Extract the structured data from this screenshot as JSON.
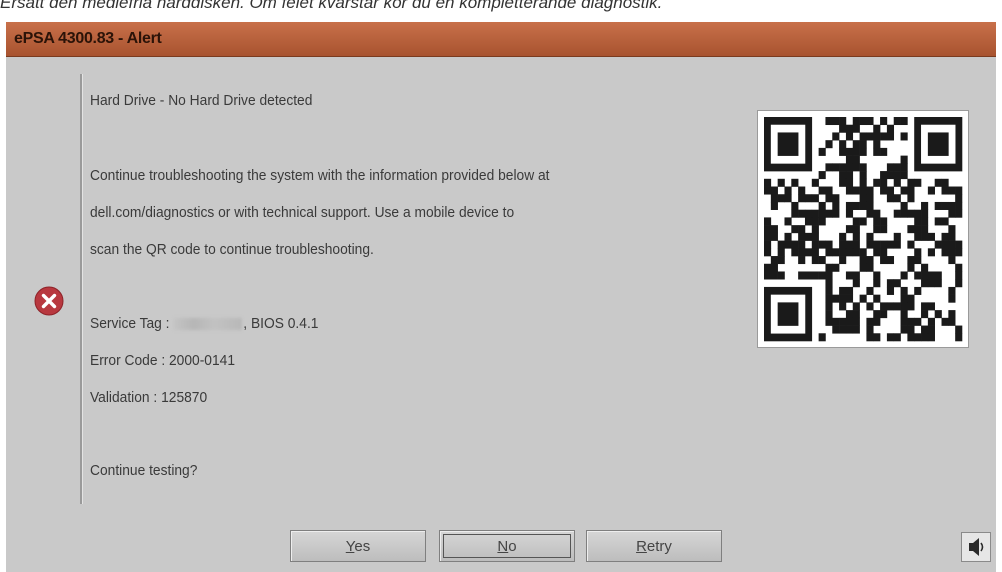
{
  "caption": "Ersätt den mediefria hårddisken. Om felet kvarstår kör du en kompletterande diagnostik.",
  "window": {
    "title": "ePSA 4300.83 - Alert"
  },
  "message": {
    "heading": "Hard Drive - No Hard Drive detected",
    "line1": "Continue troubleshooting the system with the information provided below at",
    "line2": "dell.com/diagnostics or with technical support.  Use a mobile device to",
    "line3": "scan the QR code to continue troubleshooting.",
    "service_tag_label": "Service Tag :",
    "bios": ", BIOS 0.4.1",
    "error_code": "Error Code : 2000-0141",
    "validation": "Validation : 125870",
    "prompt": "Continue testing?"
  },
  "buttons": {
    "yes": {
      "mnemonic": "Y",
      "rest": "es"
    },
    "no": {
      "mnemonic": "N",
      "rest": "o"
    },
    "retry": {
      "mnemonic": "R",
      "rest": "etry"
    }
  },
  "icons": {
    "error": "error-x-icon",
    "qr": "qr-code-icon",
    "speaker": "speaker-icon"
  },
  "colors": {
    "titlebar": "#b45c37",
    "error_icon": "#b8383f",
    "background": "#c9c9c9"
  }
}
